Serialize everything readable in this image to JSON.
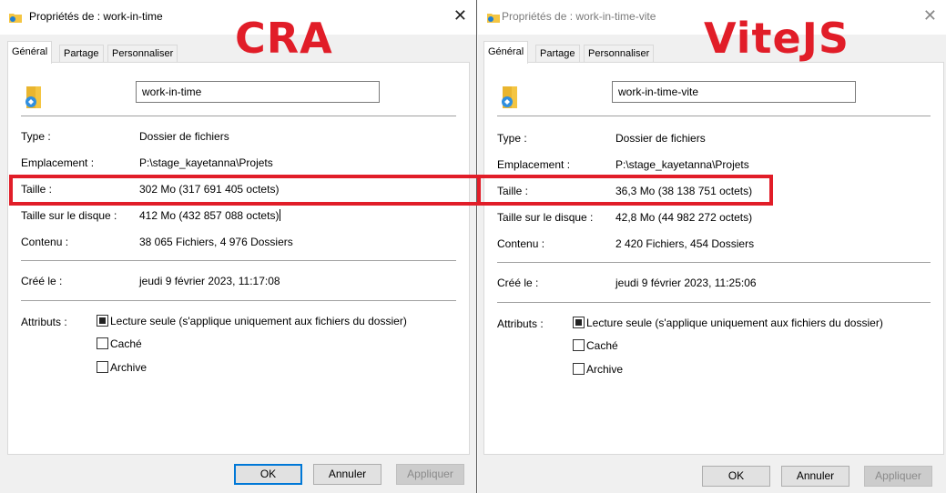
{
  "overlay": {
    "left_label": "CRA",
    "right_label": "ViteJS",
    "highlight_color": "#e11d28"
  },
  "left_window": {
    "title": "Propriétés de : work-in-time",
    "tabs": [
      "Général",
      "Partage",
      "Personnaliser"
    ],
    "name": "work-in-time",
    "type_label": "Type :",
    "type_value": "Dossier de fichiers",
    "location_label": "Emplacement :",
    "location_value": "P:\\stage_kayetanna\\Projets",
    "size_label": "Taille :",
    "size_value": "302 Mo (317 691 405 octets)",
    "disk_size_label": "Taille sur le disque :",
    "disk_size_value": "412 Mo (432 857 088 octets)",
    "contents_label": "Contenu :",
    "contents_value": "38 065 Fichiers, 4 976 Dossiers",
    "created_label": "Créé le :",
    "created_value": "jeudi 9 février 2023, 11:17:08",
    "attributes_label": "Attributs :",
    "attr_readonly": "Lecture seule (s'applique uniquement aux fichiers du dossier)",
    "attr_hidden": "Caché",
    "attr_archive": "Archive",
    "ok": "OK",
    "cancel": "Annuler",
    "apply": "Appliquer"
  },
  "right_window": {
    "title": "Propriétés de : work-in-time-vite",
    "tabs": [
      "Général",
      "Partage",
      "Personnaliser"
    ],
    "name": "work-in-time-vite",
    "type_label": "Type :",
    "type_value": "Dossier de fichiers",
    "location_label": "Emplacement :",
    "location_value": "P:\\stage_kayetanna\\Projets",
    "size_label": "Taille :",
    "size_value": "36,3 Mo (38 138 751 octets)",
    "disk_size_label": "Taille sur le disque :",
    "disk_size_value": "42,8 Mo (44 982 272 octets)",
    "contents_label": "Contenu :",
    "contents_value": "2 420 Fichiers, 454 Dossiers",
    "created_label": "Créé le :",
    "created_value": "jeudi 9 février 2023, 11:25:06",
    "attributes_label": "Attributs :",
    "attr_readonly": "Lecture seule (s'applique uniquement aux fichiers du dossier)",
    "attr_hidden": "Caché",
    "attr_archive": "Archive",
    "ok": "OK",
    "cancel": "Annuler",
    "apply": "Appliquer"
  },
  "icons": {
    "title_icon": "folder-icon",
    "close_icon": "close-icon",
    "folder_icon": "folder-icon"
  }
}
